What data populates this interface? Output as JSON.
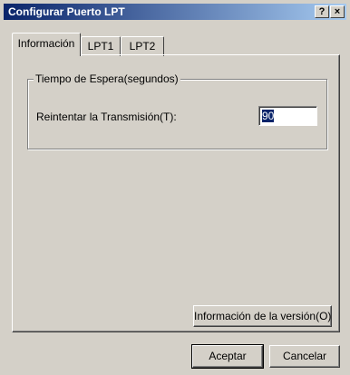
{
  "window": {
    "title": "Configurar Puerto LPT",
    "help_glyph": "?",
    "close_glyph": "×"
  },
  "tabs": [
    {
      "label": "Información",
      "active": true
    },
    {
      "label": "LPT1",
      "active": false
    },
    {
      "label": "LPT2",
      "active": false
    }
  ],
  "group": {
    "legend": "Tiempo de Espera(segundos)",
    "retry_label": "Reintentar la Transmisión(T):",
    "retry_value": "90"
  },
  "buttons": {
    "version": "Información de la versión(O)",
    "ok": "Aceptar",
    "cancel": "Cancelar"
  },
  "colors": {
    "face": "#d4d0c8",
    "title_start": "#0a246a",
    "title_end": "#a6caf0",
    "selection": "#0a246a"
  }
}
